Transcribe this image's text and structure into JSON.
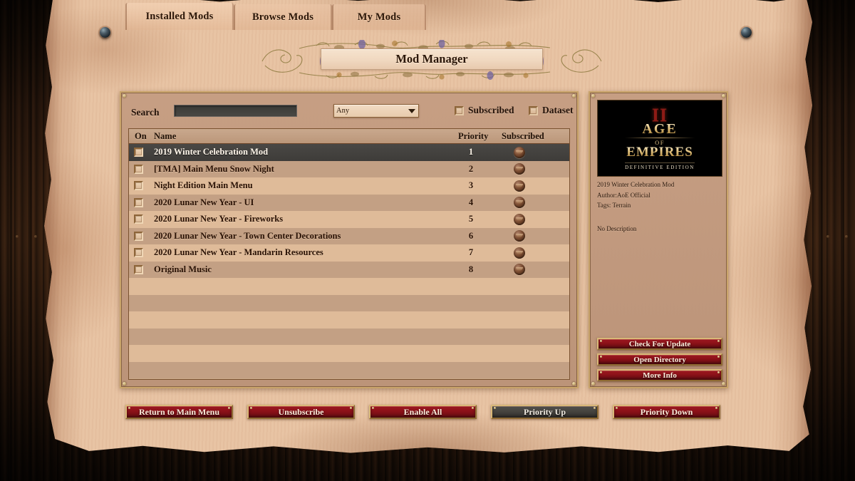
{
  "window": {
    "title": "Mod Manager"
  },
  "tabs": [
    {
      "label": "Installed Mods",
      "active": true
    },
    {
      "label": "Browse Mods",
      "active": false
    },
    {
      "label": "My Mods",
      "active": false
    }
  ],
  "toolbar": {
    "search_label": "Search",
    "search_value": "",
    "search_placeholder": "",
    "filter_selected": "Any",
    "filter_options": [
      "Any"
    ],
    "subscribed_label": "Subscribed",
    "subscribed_checked": false,
    "dataset_label": "Dataset",
    "dataset_checked": false
  },
  "list": {
    "columns": {
      "on": "On",
      "name": "Name",
      "priority": "Priority",
      "subscribed": "Subscribed"
    },
    "rows": [
      {
        "on": false,
        "name": "2019 Winter Celebration Mod",
        "priority": "1",
        "selected": true
      },
      {
        "on": false,
        "name": "[TMA] Main Menu Snow Night",
        "priority": "2",
        "selected": false
      },
      {
        "on": false,
        "name": "Night Edition Main Menu",
        "priority": "3",
        "selected": false
      },
      {
        "on": false,
        "name": "2020 Lunar New Year - UI",
        "priority": "4",
        "selected": false
      },
      {
        "on": false,
        "name": "2020 Lunar New Year - Fireworks",
        "priority": "5",
        "selected": false
      },
      {
        "on": false,
        "name": "2020 Lunar New Year - Town Center Decorations",
        "priority": "6",
        "selected": false
      },
      {
        "on": false,
        "name": "2020 Lunar New Year - Mandarin Resources",
        "priority": "7",
        "selected": false
      },
      {
        "on": false,
        "name": "Original Music",
        "priority": "8",
        "selected": false
      }
    ],
    "empty_row_count": 6
  },
  "details": {
    "thumbnail": {
      "numeral": "II",
      "line1": "AGE",
      "connector": "OF",
      "line2": "EMPIRES",
      "edition": "DEFINITIVE EDITION"
    },
    "name": "2019 Winter Celebration Mod",
    "author": "Author:AoE Official",
    "tags": "Tags: Terrain",
    "description": "No Description",
    "buttons": [
      {
        "label": "Check For Update",
        "style": "red"
      },
      {
        "label": "Open Directory",
        "style": "red"
      },
      {
        "label": "More Info",
        "style": "red"
      }
    ]
  },
  "footer": {
    "buttons": [
      {
        "label": "Return to Main Menu",
        "style": "red"
      },
      {
        "label": "Unsubscribe",
        "style": "red"
      },
      {
        "label": "Enable All",
        "style": "red"
      },
      {
        "label": "Priority Up",
        "style": "dark"
      },
      {
        "label": "Priority Down",
        "style": "red"
      }
    ]
  },
  "theme": {
    "red_button": "#8d1219",
    "gold_border": "#c9a46a",
    "parchment": "#e7c2a2",
    "panel_bg": "#ba9277",
    "row_odd": "#dfbb99",
    "row_even": "#c3a084",
    "row_selected": "#43413e",
    "wood": "#46291 5"
  }
}
